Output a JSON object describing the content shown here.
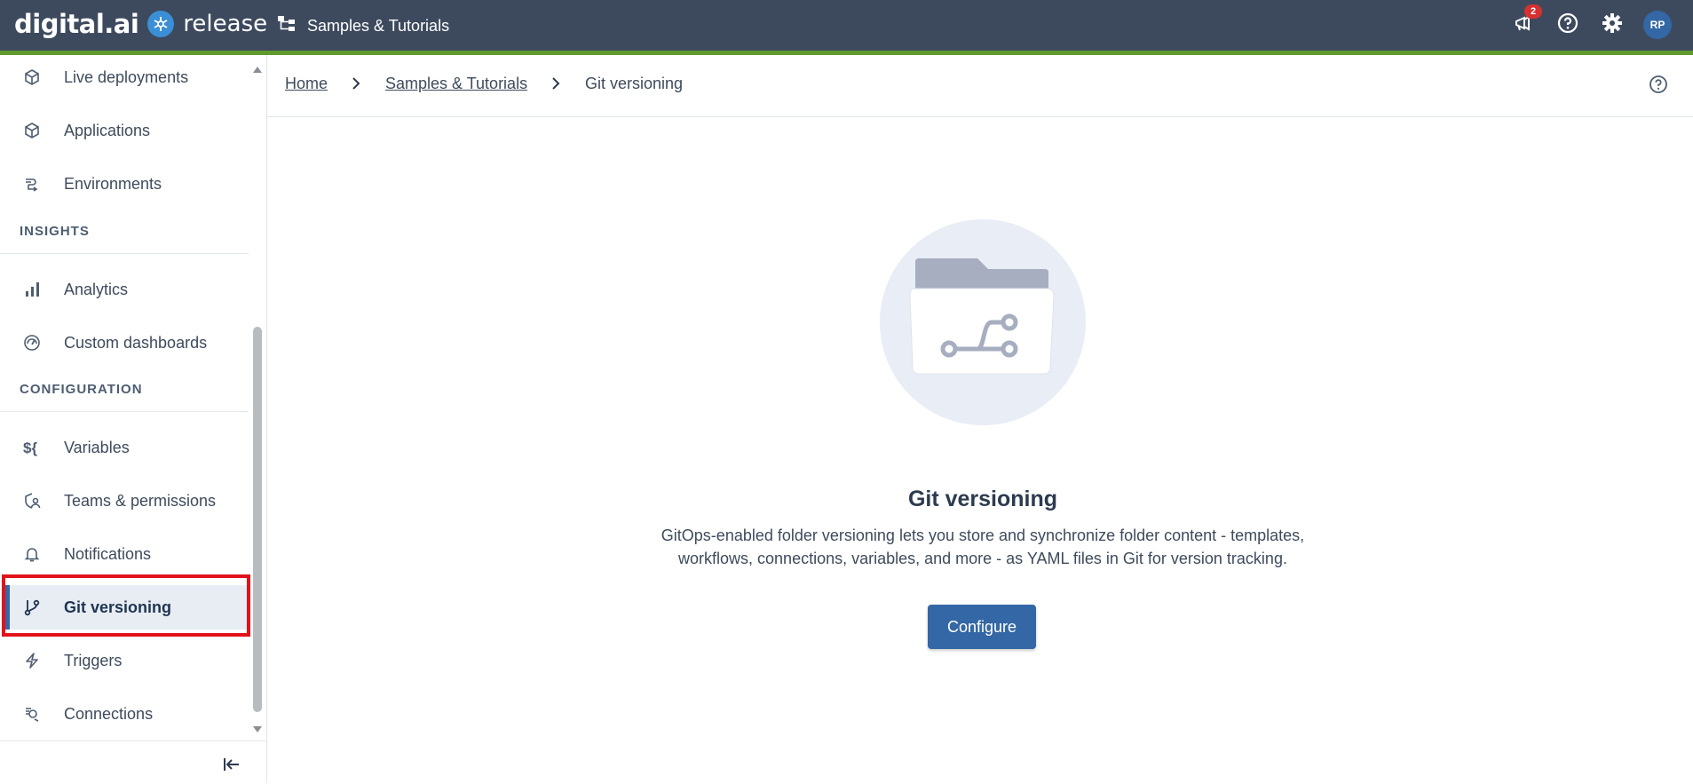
{
  "header": {
    "logo_digital": "digital.ai",
    "logo_release": "release",
    "folder_title": "Samples & Tutorials",
    "notification_count": "2",
    "avatar_initials": "RP"
  },
  "sidebar": {
    "items_top": [
      {
        "label": "Live deployments",
        "icon": "cube-icon"
      },
      {
        "label": "Applications",
        "icon": "cube-icon"
      },
      {
        "label": "Environments",
        "icon": "environments-icon"
      }
    ],
    "insights_header": "INSIGHTS",
    "insights_items": [
      {
        "label": "Analytics",
        "icon": "bar-chart-icon"
      },
      {
        "label": "Custom dashboards",
        "icon": "dashboard-gauge-icon"
      }
    ],
    "configuration_header": "CONFIGURATION",
    "configuration_items": [
      {
        "label": "Variables",
        "icon": "variables-icon"
      },
      {
        "label": "Teams & permissions",
        "icon": "teams-icon"
      },
      {
        "label": "Notifications",
        "icon": "bell-icon"
      },
      {
        "label": "Git versioning",
        "icon": "git-branch-icon",
        "active": true
      },
      {
        "label": "Triggers",
        "icon": "lightning-icon"
      },
      {
        "label": "Connections",
        "icon": "connections-icon"
      }
    ]
  },
  "breadcrumb": {
    "home": "Home",
    "folder": "Samples & Tutorials",
    "current": "Git versioning"
  },
  "main": {
    "title": "Git versioning",
    "description_line1": "GitOps-enabled folder versioning lets you store and synchronize folder content - templates,",
    "description_line2": "workflows, connections, variables, and more - as YAML files in Git for version tracking.",
    "configure_label": "Configure"
  },
  "colors": {
    "header_bg": "#3d4a5e",
    "header_accent": "#5f9b2c",
    "primary": "#3467a5",
    "highlight": "#e2121a"
  }
}
